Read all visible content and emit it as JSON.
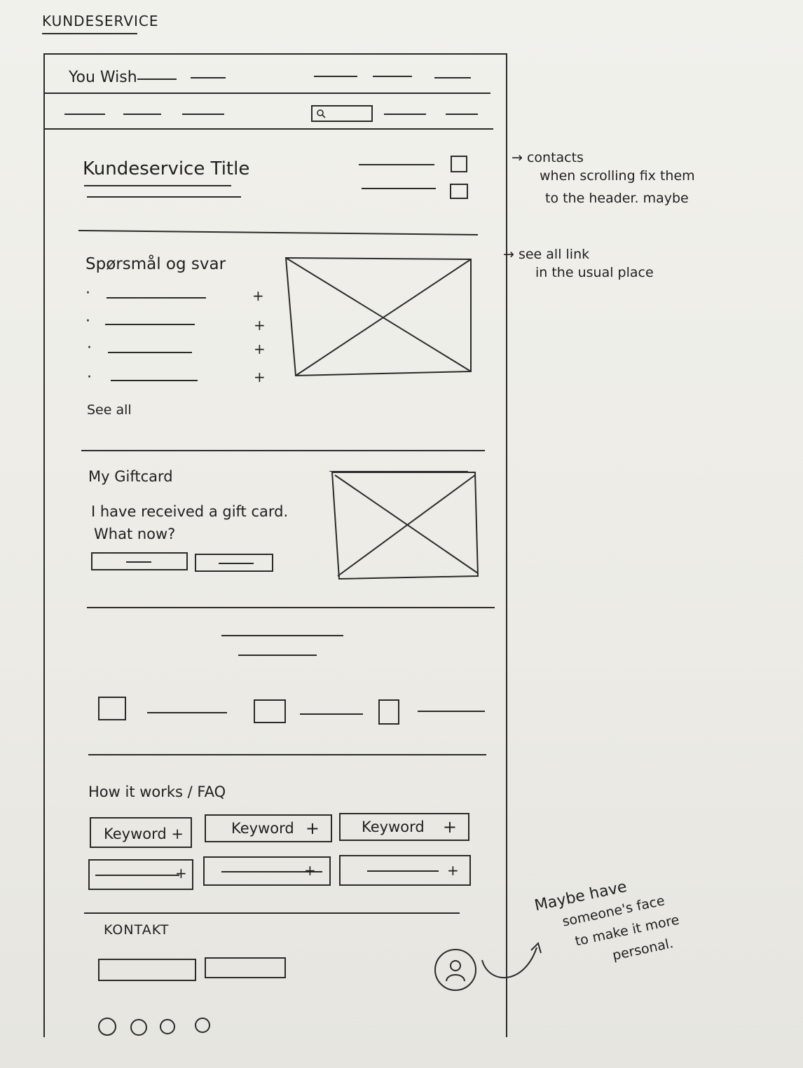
{
  "page_label": "KUNDESERVICE",
  "header": {
    "logo": "You Wish"
  },
  "title_section": {
    "title": "Kundeservice Title"
  },
  "qa_section": {
    "heading": "Spørsmål og svar",
    "expand_symbol": "+",
    "bullet": "·",
    "see_all": "See all"
  },
  "giftcard_section": {
    "heading": "My Giftcard",
    "text_line1": "I have received a gift card.",
    "text_line2": "What now?"
  },
  "faq_section": {
    "heading": "How it works / FAQ",
    "keywords": [
      {
        "label": "Keyword +",
        "plus": ""
      },
      {
        "label": "Keyword",
        "plus": "+"
      },
      {
        "label": "Keyword",
        "plus": "+"
      }
    ],
    "row_plus": "+"
  },
  "contact_section": {
    "heading": "KONTAKT"
  },
  "annotations": {
    "contacts_lines": [
      "→ contacts",
      "when scrolling fix them",
      "to the header. maybe"
    ],
    "see_all_lines": [
      "→ see all link",
      "in the usual place"
    ],
    "face_lines": [
      "Maybe have",
      "someone's face",
      "to make it more",
      "personal."
    ]
  }
}
